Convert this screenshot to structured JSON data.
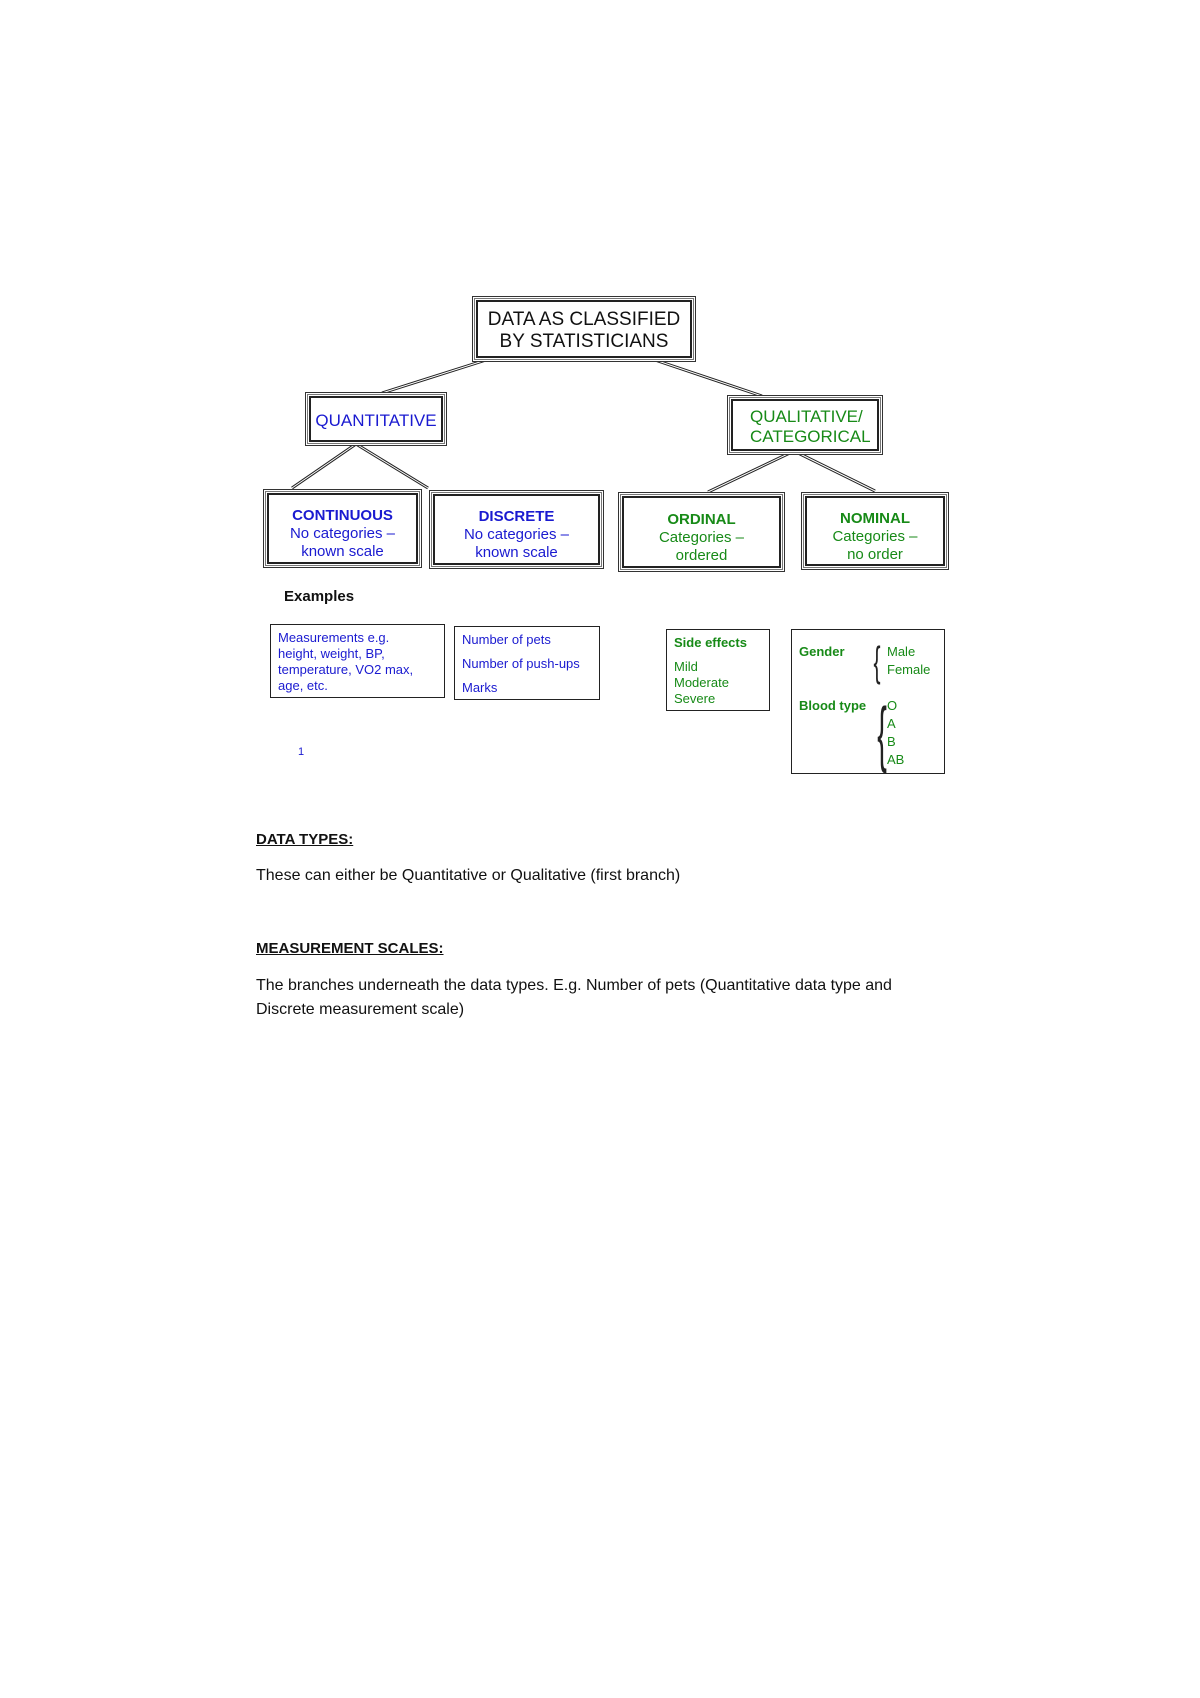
{
  "diagram": {
    "root": {
      "line1": "DATA AS CLASSIFIED",
      "line2": "BY STATISTICIANS"
    },
    "quantitative": {
      "label": "QUANTITATIVE",
      "color": "#1a1ad0"
    },
    "qualitative": {
      "line1": "QUALITATIVE/",
      "line2": "CATEGORICAL",
      "color": "#178a17"
    },
    "continuous": {
      "title": "CONTINUOUS",
      "line1": "No categories –",
      "line2": "known scale"
    },
    "discrete": {
      "title": "DISCRETE",
      "line1": "No categories –",
      "line2": "known scale"
    },
    "ordinal": {
      "title": "ORDINAL",
      "line1": "Categories –",
      "line2": "ordered"
    },
    "nominal": {
      "title": "NOMINAL",
      "line1": "Categories –",
      "line2": "no order"
    },
    "examples_label": "Examples",
    "continuous_examples": [
      "Measurements e.g.",
      "height, weight, BP,",
      "temperature, VO2 max,",
      "age, etc."
    ],
    "discrete_examples": [
      "Number of pets",
      "Number of push-ups",
      "Marks"
    ],
    "ordinal_examples": {
      "heading": "Side effects",
      "items": [
        "Mild",
        "Moderate",
        "Severe"
      ]
    },
    "nominal_examples": {
      "gender": {
        "heading": "Gender",
        "items": [
          "Male",
          "Female"
        ]
      },
      "blood_type": {
        "heading": "Blood type",
        "items": [
          "O",
          "A",
          "B",
          "AB"
        ]
      }
    },
    "footnote": "1"
  },
  "text": {
    "data_types_heading": "DATA TYPES:",
    "data_types_body": "These can either be Quantitative or Qualitative (first branch)",
    "measurement_heading": "MEASUREMENT SCALES:",
    "measurement_body_line1": "The branches underneath the data types. E.g. Number of pets (Quantitative data type and",
    "measurement_body_line2": "Discrete measurement scale)"
  }
}
